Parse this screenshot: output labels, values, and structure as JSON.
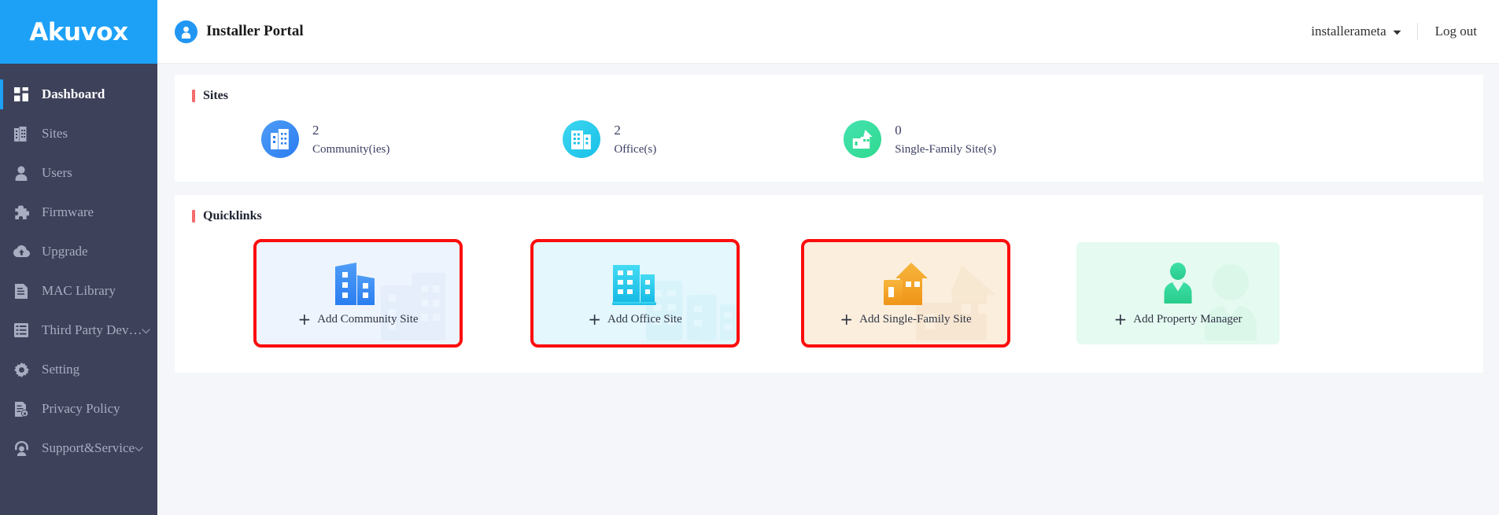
{
  "brand": {
    "name": "Akuvox",
    "logo_bg": "#1da1f7"
  },
  "topbar": {
    "portal_title": "Installer Portal",
    "avatar_icon": "user-avatar-icon",
    "username": "installerameta",
    "caret_icon": "chevron-down-icon",
    "logout_label": "Log out"
  },
  "sidebar": {
    "items": [
      {
        "label": "Dashboard",
        "icon": "dashboard-icon",
        "active": true,
        "expandable": false
      },
      {
        "label": "Sites",
        "icon": "building-icon",
        "active": false,
        "expandable": false
      },
      {
        "label": "Users",
        "icon": "user-icon",
        "active": false,
        "expandable": false
      },
      {
        "label": "Firmware",
        "icon": "puzzle-icon",
        "active": false,
        "expandable": false
      },
      {
        "label": "Upgrade",
        "icon": "cloud-upload-icon",
        "active": false,
        "expandable": false
      },
      {
        "label": "MAC Library",
        "icon": "document-icon",
        "active": false,
        "expandable": false
      },
      {
        "label": "Third Party Dev…",
        "icon": "list-document-icon",
        "active": false,
        "expandable": true
      },
      {
        "label": "Setting",
        "icon": "gear-icon",
        "active": false,
        "expandable": false
      },
      {
        "label": "Privacy Policy",
        "icon": "document-lock-icon",
        "active": false,
        "expandable": false
      },
      {
        "label": "Support&Service",
        "icon": "headset-support-icon",
        "active": false,
        "expandable": true
      }
    ]
  },
  "sites_panel": {
    "title": "Sites",
    "accent": "#f56c6c",
    "stats": [
      {
        "value": "2",
        "label": "Community(ies)",
        "icon": "community-building-icon",
        "color": "#2a7df0"
      },
      {
        "value": "2",
        "label": "Office(s)",
        "icon": "office-building-icon",
        "color": "#17c0e8"
      },
      {
        "value": "0",
        "label": "Single-Family Site(s)",
        "icon": "house-icon",
        "color": "#2fd98f"
      }
    ]
  },
  "quicklinks_panel": {
    "title": "Quicklinks",
    "accent": "#f56c6c",
    "highlight_color": "#fc0d0d",
    "cards": [
      {
        "label": "Add Community Site",
        "icon": "community-building-icon",
        "highlighted": true,
        "bg": "#eef4fd"
      },
      {
        "label": "Add Office Site",
        "icon": "office-building-icon",
        "highlighted": true,
        "bg": "#e3f7fd"
      },
      {
        "label": "Add Single-Family Site",
        "icon": "house-icon",
        "highlighted": true,
        "bg": "#fbeedd"
      },
      {
        "label": "Add Property Manager",
        "icon": "manager-person-icon",
        "highlighted": false,
        "bg": "#e5faf0"
      }
    ]
  }
}
